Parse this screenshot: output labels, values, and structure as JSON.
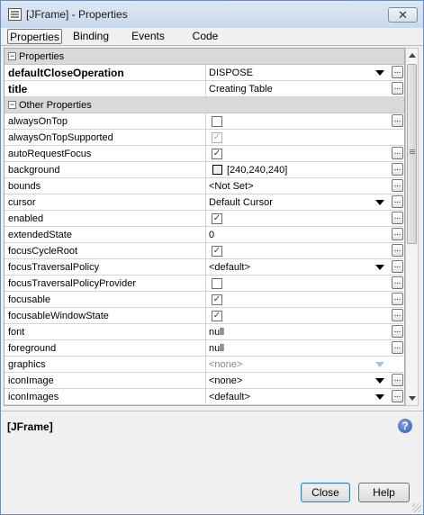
{
  "window": {
    "title": "[JFrame] - Properties",
    "close_glyph": "✕"
  },
  "tabs": [
    {
      "label": "Properties",
      "active": true
    },
    {
      "label": "Binding",
      "active": false
    },
    {
      "label": "Events",
      "active": false
    },
    {
      "label": "Code",
      "active": false
    }
  ],
  "categories": {
    "properties": "Properties",
    "other": "Other Properties",
    "toggle_glyph": "−"
  },
  "rows": [
    {
      "name": "defaultCloseOperation",
      "bold": true,
      "value": "DISPOSE",
      "dropdown": true,
      "ellipsis": true
    },
    {
      "name": "title",
      "bold": true,
      "value": "Creating Table",
      "ellipsis": true
    },
    {
      "name": "alwaysOnTop",
      "checkbox": false,
      "ellipsis": true
    },
    {
      "name": "alwaysOnTopSupported",
      "checkbox": true,
      "disabled": true
    },
    {
      "name": "autoRequestFocus",
      "checkbox": true,
      "ellipsis": true
    },
    {
      "name": "background",
      "value": "[240,240,240]",
      "swatch": true,
      "ellipsis": true
    },
    {
      "name": "bounds",
      "value": "<Not Set>",
      "ellipsis": true
    },
    {
      "name": "cursor",
      "value": "Default Cursor",
      "dropdown": true,
      "ellipsis": true
    },
    {
      "name": "enabled",
      "checkbox": true,
      "ellipsis": true
    },
    {
      "name": "extendedState",
      "value": "0",
      "ellipsis": true
    },
    {
      "name": "focusCycleRoot",
      "checkbox": true,
      "ellipsis": true
    },
    {
      "name": "focusTraversalPolicy",
      "value": "<default>",
      "dropdown": true,
      "ellipsis": true
    },
    {
      "name": "focusTraversalPolicyProvider",
      "checkbox": false,
      "ellipsis": true
    },
    {
      "name": "focusable",
      "checkbox": true,
      "ellipsis": true
    },
    {
      "name": "focusableWindowState",
      "checkbox": true,
      "ellipsis": true
    },
    {
      "name": "font",
      "value": "null",
      "ellipsis": true
    },
    {
      "name": "foreground",
      "value": "null",
      "ellipsis": true
    },
    {
      "name": "graphics",
      "value": "<none>",
      "dim": true,
      "dropdown": true,
      "dropdown_dim": true
    },
    {
      "name": "iconImage",
      "value": "<none>",
      "dropdown": true,
      "ellipsis": true
    },
    {
      "name": "iconImages",
      "value": "<default>",
      "dropdown": true,
      "ellipsis": true
    }
  ],
  "description": {
    "heading": "[JFrame]"
  },
  "buttons": {
    "close": "Close",
    "help": "Help"
  },
  "help_icon_glyph": "?",
  "ellipsis_glyph": "...",
  "check_glyph": "✓"
}
